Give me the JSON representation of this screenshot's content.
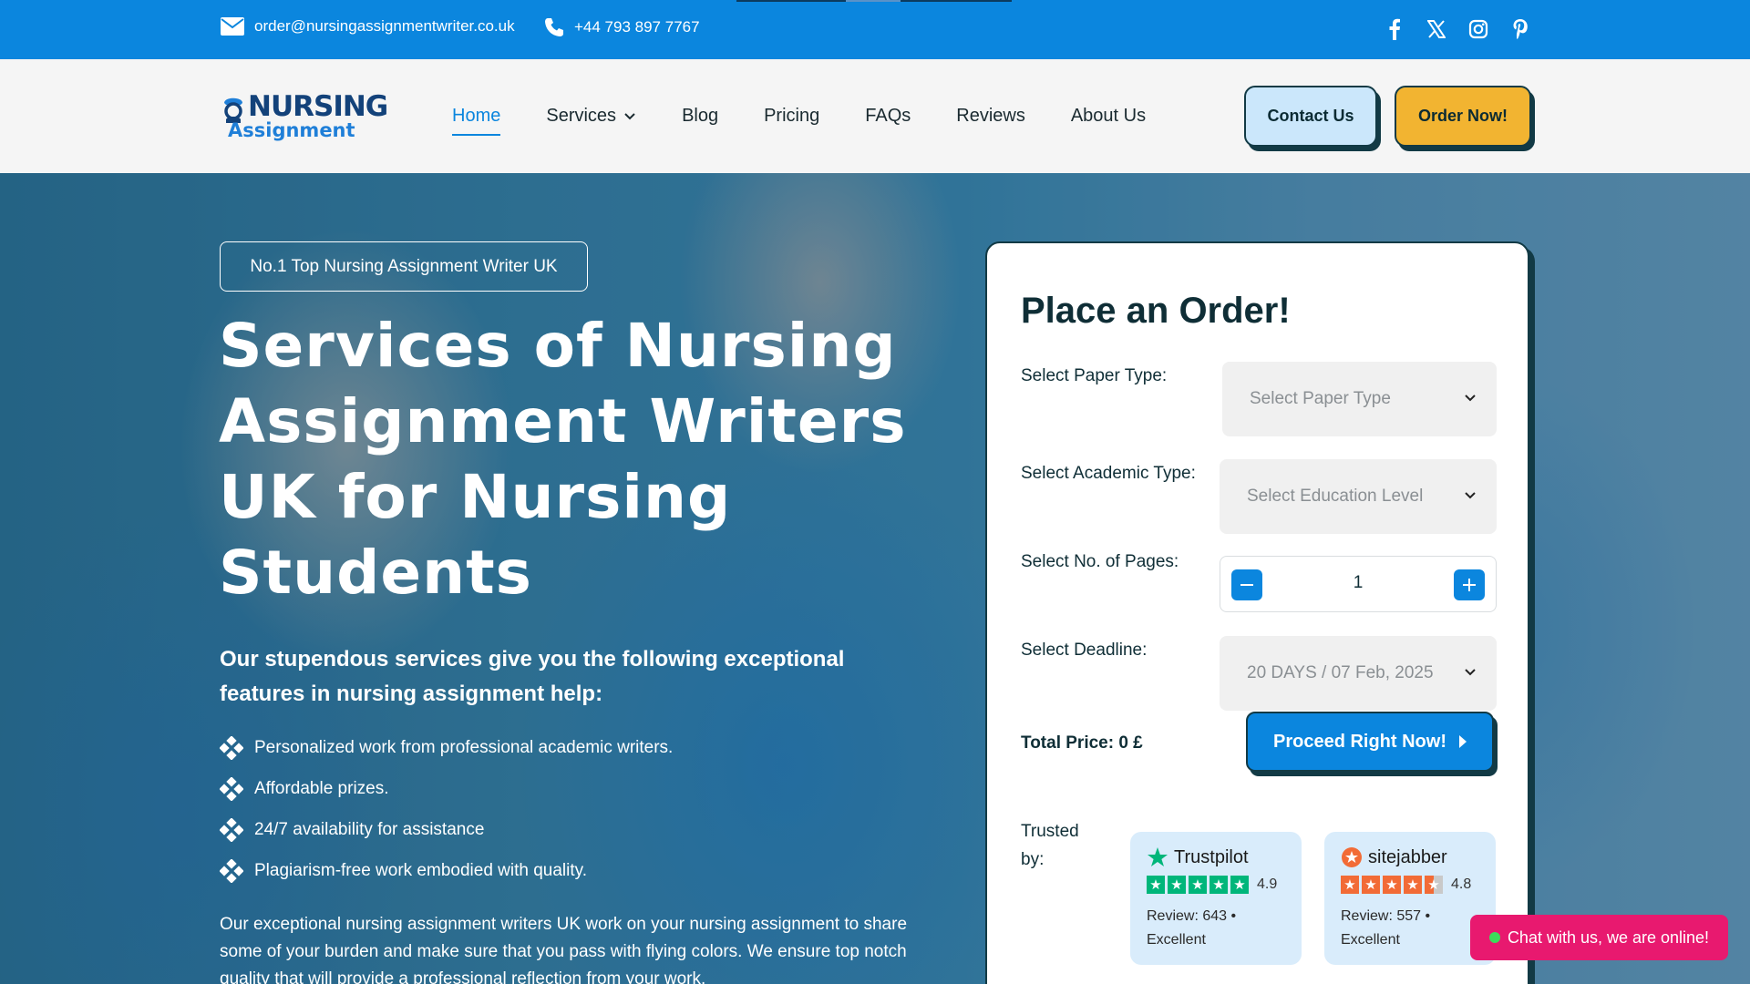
{
  "topbar": {
    "email": "order@nursingassignmentwriter.co.uk",
    "phone": "+44 793 897 7767",
    "social_icons": [
      "facebook-icon",
      "x-twitter-icon",
      "instagram-icon",
      "pinterest-icon"
    ]
  },
  "header": {
    "logo_line1": "NURSING",
    "logo_line2": "Assignment",
    "nav": [
      {
        "label": "Home",
        "active": true
      },
      {
        "label": "Services",
        "dropdown": true
      },
      {
        "label": "Blog"
      },
      {
        "label": "Pricing"
      },
      {
        "label": "FAQs"
      },
      {
        "label": "Reviews"
      },
      {
        "label": "About Us"
      }
    ],
    "contact_button": "Contact Us",
    "order_button": "Order Now!"
  },
  "hero": {
    "badge": "No.1  Top Nursing Assignment Writer UK",
    "title": "Services of Nursing Assignment Writers UK for Nursing Students",
    "lead": "Our stupendous services give you the following exceptional features in nursing assignment help:",
    "features": [
      "Personalized work from professional academic writers.",
      "Affordable prizes.",
      "24/7 availability for assistance",
      "Plagiarism-free work embodied with quality."
    ],
    "paragraph": "Our exceptional nursing assignment writers UK work on your nursing assignment to share some of your burden and make sure that you pass with flying colors. We ensure top notch quality that will provide a professional reflection from your work."
  },
  "order_form": {
    "title": "Place an Order!",
    "paper_type_label": "Select Paper Type:",
    "paper_type_value": "Select Paper Type",
    "academic_label": "Select Academic Type:",
    "academic_value": "Select Education Level",
    "pages_label": "Select No. of Pages:",
    "pages_value": "1",
    "deadline_label": "Select Deadline:",
    "deadline_value": "20 DAYS / 07 Feb, 2025",
    "total_label": "Total Price: 0 £",
    "proceed_button": "Proceed Right Now!",
    "trusted_label": "Trusted by:",
    "reviews": [
      {
        "brand": "Trustpilot",
        "score": "4.9",
        "meta": "Review: 643 • Excellent",
        "color": "#00b67a",
        "stars": 5
      },
      {
        "brand": "sitejabber",
        "score": "4.8",
        "meta": "Review: 557 • Excellent",
        "color": "#f26b36",
        "stars": 4.5
      }
    ]
  },
  "chat": {
    "label": "Chat with us, we are online!"
  },
  "colors": {
    "primary": "#0b86de",
    "accent": "#f2b431",
    "dark": "#123a45",
    "chat": "#e8196f"
  }
}
